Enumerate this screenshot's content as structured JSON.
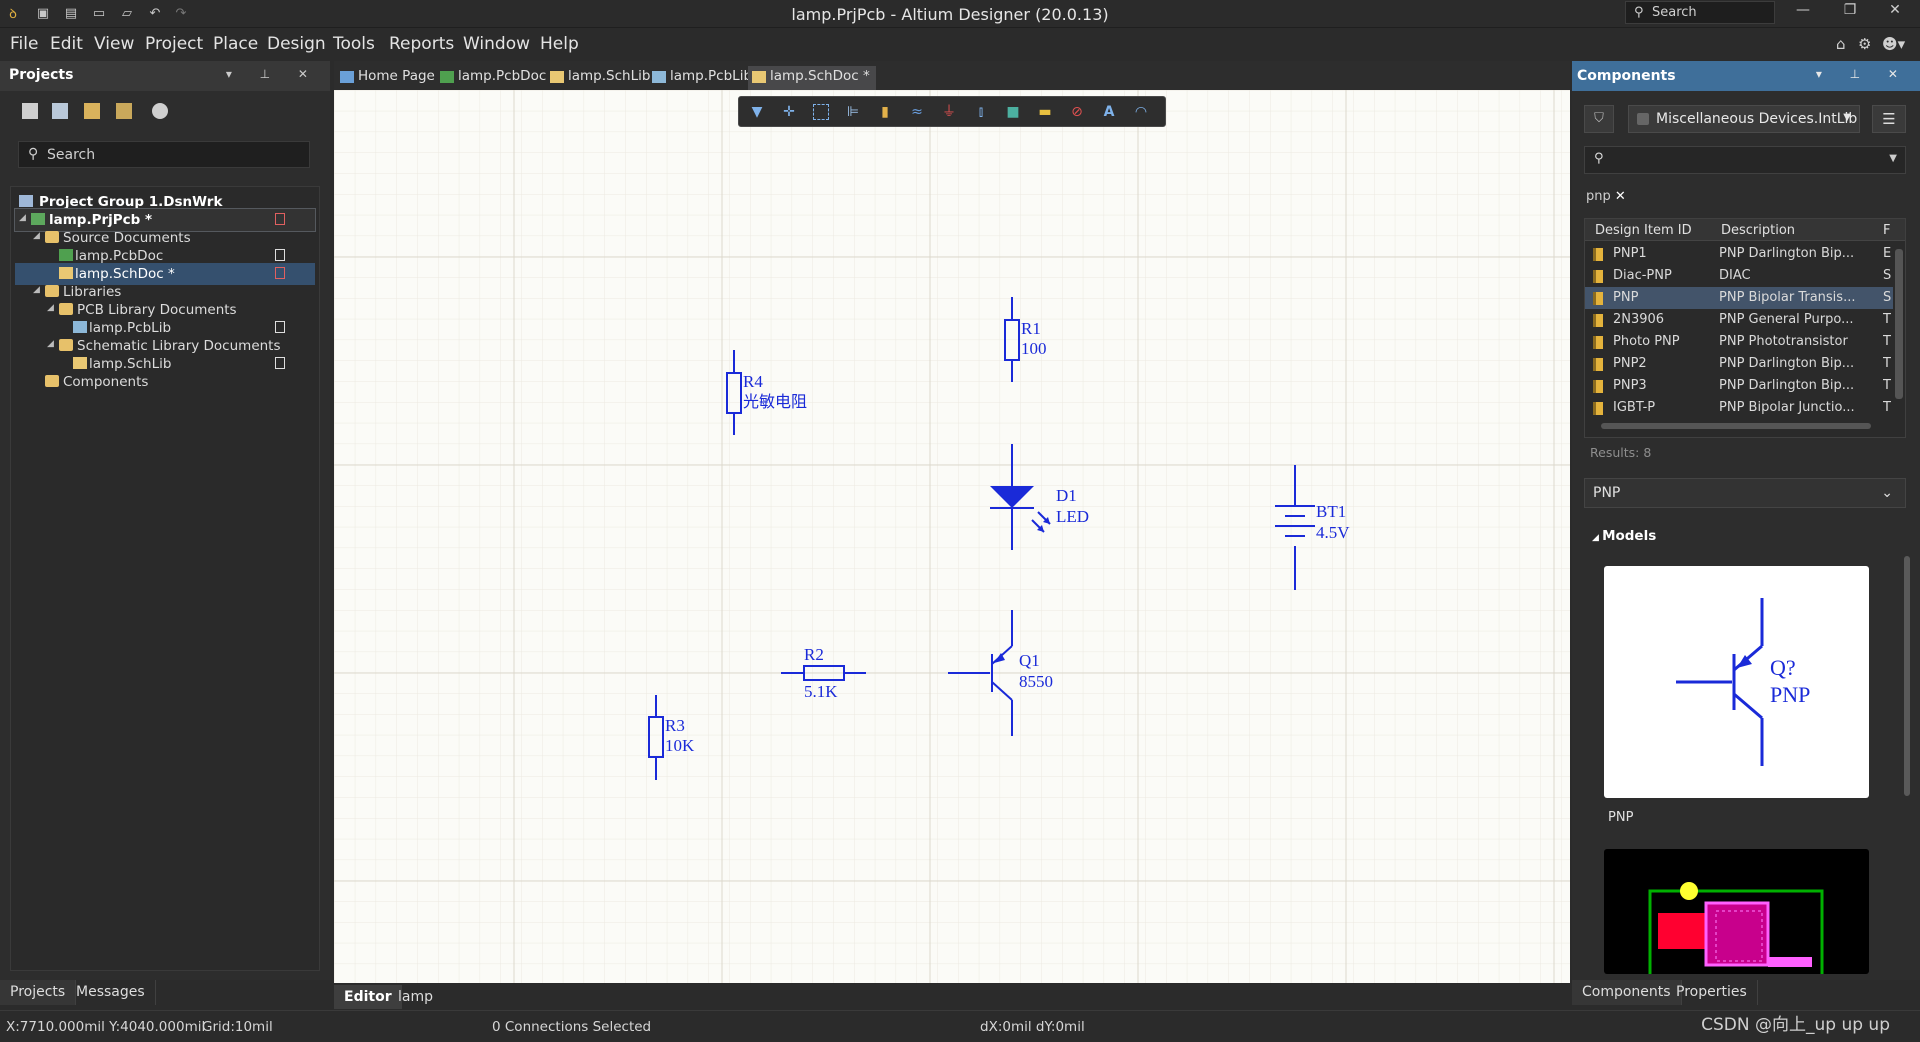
{
  "window": {
    "title": "lamp.PrjPcb - Altium Designer (20.0.13)",
    "search_placeholder": "Search"
  },
  "menu": [
    "File",
    "Edit",
    "View",
    "Project",
    "Place",
    "Design",
    "Tools",
    "Reports",
    "Window",
    "Help"
  ],
  "projects_panel": {
    "title": "Projects",
    "search_placeholder": "Search",
    "tree": {
      "group": "Project Group 1.DsnWrk",
      "project": "lamp.PrjPcb *",
      "source_documents": "Source Documents",
      "pcbdoc": "lamp.PcbDoc",
      "schdoc": "lamp.SchDoc *",
      "libraries": "Libraries",
      "pcb_lib_docs": "PCB Library Documents",
      "pcblib": "lamp.PcbLib",
      "sch_lib_docs": "Schematic Library Documents",
      "schlib": "lamp.SchLib",
      "components": "Components"
    },
    "bottom_tabs": [
      "Projects",
      "Messages"
    ]
  },
  "doc_tabs": [
    "Home Page",
    "lamp.PcbDoc",
    "lamp.SchLib",
    "lamp.PcbLib",
    "lamp.SchDoc *"
  ],
  "schematic": {
    "r1": {
      "designator": "R1",
      "value": "100"
    },
    "r4": {
      "designator": "R4",
      "value": "光敏电阻"
    },
    "d1": {
      "designator": "D1",
      "value": "LED"
    },
    "bt1": {
      "designator": "BT1",
      "value": "4.5V"
    },
    "r2": {
      "designator": "R2",
      "value": "5.1K"
    },
    "q1": {
      "designator": "Q1",
      "value": "8550"
    },
    "r3": {
      "designator": "R3",
      "value": "10K"
    },
    "colors": {
      "wire": "#1a2ad8",
      "grid": "#ece9e1",
      "grid_major": "#dcd8cc"
    }
  },
  "editor_tabs": [
    "Editor",
    "lamp"
  ],
  "components_panel": {
    "title": "Components",
    "library": "Miscellaneous Devices.IntLib",
    "query": "pnp",
    "columns": [
      "Design Item ID",
      "Description",
      "F"
    ],
    "rows": [
      {
        "id": "PNP1",
        "desc": "PNP Darlington Bip...",
        "f": "E"
      },
      {
        "id": "Diac-PNP",
        "desc": "DIAC",
        "f": "S"
      },
      {
        "id": "PNP",
        "desc": "PNP Bipolar Transis...",
        "f": "S"
      },
      {
        "id": "2N3906",
        "desc": "PNP General Purpo...",
        "f": "T"
      },
      {
        "id": "Photo PNP",
        "desc": "PNP Phototransistor",
        "f": "T"
      },
      {
        "id": "PNP2",
        "desc": "PNP Darlington Bip...",
        "f": "T"
      },
      {
        "id": "PNP3",
        "desc": "PNP Darlington Bip...",
        "f": "T"
      },
      {
        "id": "IGBT-P",
        "desc": "PNP Bipolar Junctio...",
        "f": "T"
      }
    ],
    "results": "Results: 8",
    "selected_name": "PNP",
    "models_label": "Models",
    "preview_designator": "Q?",
    "preview_value": "PNP",
    "model_name": "PNP",
    "bottom_tabs": [
      "Components",
      "Properties"
    ]
  },
  "status": {
    "coords": "X:7710.000mil Y:4040.000mil",
    "grid": "Grid:10mil",
    "connections": "0 Connections Selected",
    "delta": "dX:0mil dY:0mil",
    "watermark": "CSDN @向上_up up up"
  }
}
